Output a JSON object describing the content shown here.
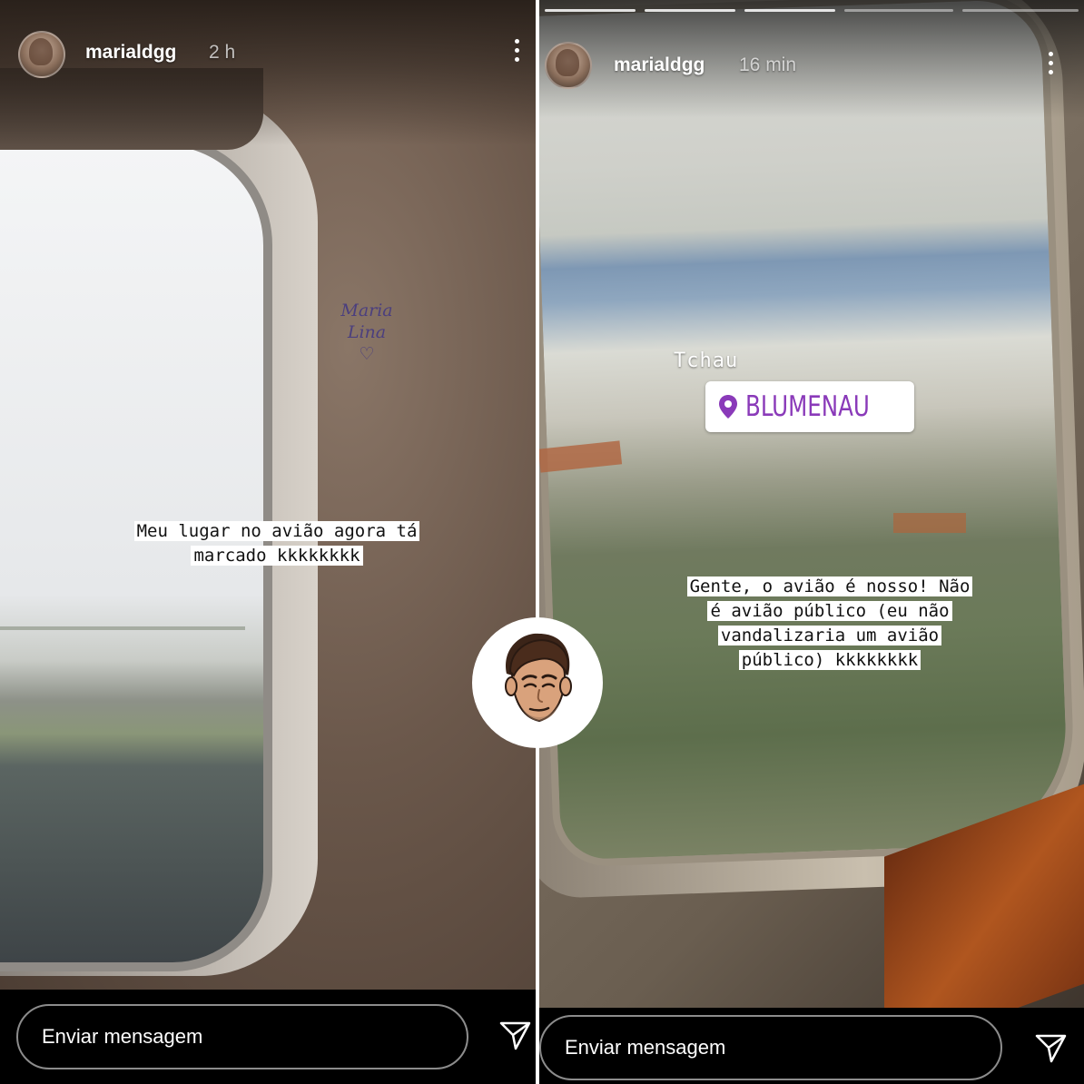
{
  "left_story": {
    "username": "marialdgg",
    "time": "2 h",
    "handwriting": [
      "Maria",
      "Lina",
      "♡"
    ],
    "caption_lines": [
      "Meu lugar no avião agora tá",
      "marcado kkkkkkkk"
    ],
    "message_placeholder": "Enviar mensagem"
  },
  "right_story": {
    "username": "marialdgg",
    "time": "16 min",
    "tchau_text": "Tchau",
    "location_sticker": "BLUMENAU",
    "caption_lines": [
      "Gente, o avião é nosso! Não",
      "é avião público (eu não",
      "vandalizaria um avião",
      "público) kkkkkkkk"
    ],
    "message_placeholder": "Enviar mensagem"
  },
  "colors": {
    "story_bg": "#0f0f0f",
    "location_purple": "#8a3ab9",
    "text_white": "#ffffff"
  },
  "icons": [
    "more-options-icon",
    "send-direct-icon",
    "location-pin-icon",
    "cartoon-avatar-icon"
  ]
}
